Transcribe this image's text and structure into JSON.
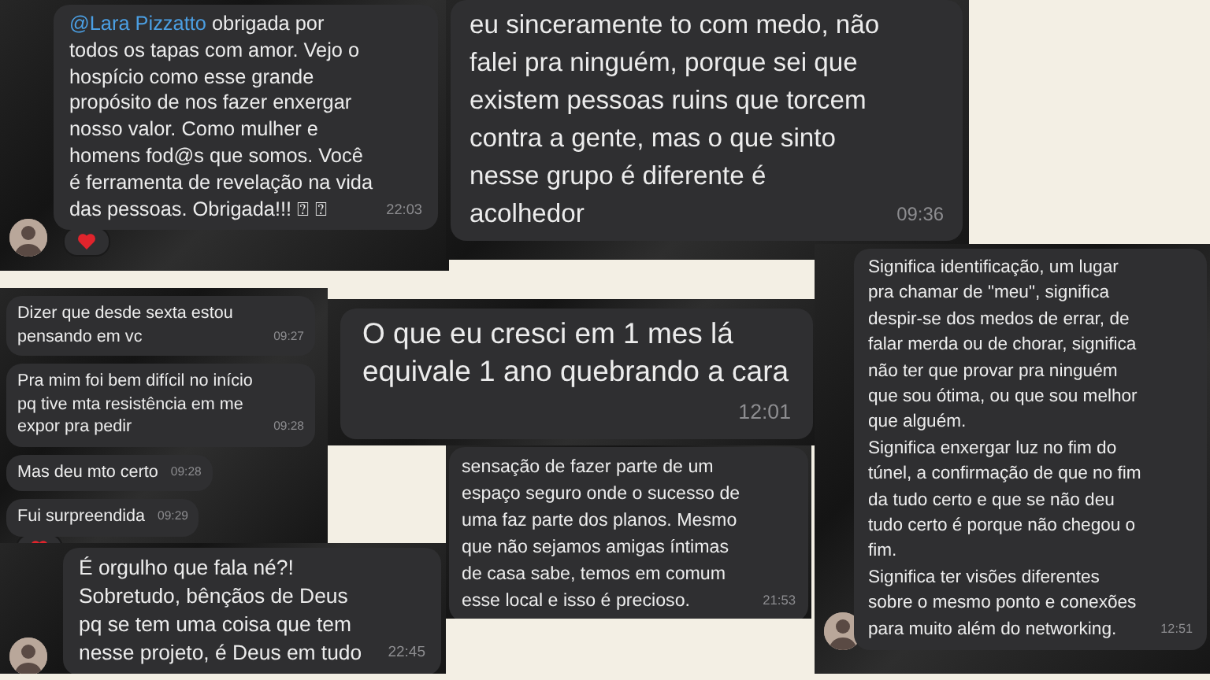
{
  "panels": [
    {
      "messages": [
        {
          "mention": "@Lara Pizzatto",
          "text": " obrigada por todos os tapas com amor. Vejo o hospício como esse grande propósito de nos fazer enxergar nosso valor. Como mulher e homens fod@s que somos. Você é ferramenta de revelação na vida das pessoas. Obrigada!!! ⍰ ⍰",
          "time": "22:03",
          "avatar": true,
          "reaction": true
        }
      ]
    },
    {
      "messages": [
        {
          "text": "eu sinceramente to com medo, não falei pra ninguém, porque sei que existem pessoas ruins que torcem contra a gente, mas o que sinto nesse grupo é diferente é acolhedor",
          "time": "09:36",
          "avatar": false,
          "reaction": false
        }
      ]
    },
    {
      "messages": [
        {
          "text": "Dizer que desde sexta estou pensando em vc",
          "time": "09:27",
          "avatar": false,
          "reaction": false
        },
        {
          "text": "Pra mim foi bem difícil no início pq tive mta resistência em me expor pra pedir",
          "time": "09:28",
          "avatar": false,
          "reaction": false
        },
        {
          "text": "Mas deu mto certo",
          "time": "09:28",
          "avatar": false,
          "reaction": false
        },
        {
          "text": "Fui surpreendida",
          "time": "09:29",
          "avatar": false,
          "reaction": true
        }
      ]
    },
    {
      "messages": [
        {
          "text": "O que eu cresci em 1 mes lá equivale 1 ano quebrando a cara",
          "time": "12:01",
          "avatar": false,
          "reaction": false
        }
      ]
    },
    {
      "messages": [
        {
          "text": "sensação de fazer parte de um espaço seguro onde o sucesso de uma faz parte dos planos. Mesmo que não sejamos amigas íntimas de casa sabe, temos em comum esse local e isso é precioso.",
          "time": "21:53",
          "avatar": false,
          "reaction": false
        }
      ]
    },
    {
      "messages": [
        {
          "text": "É orgulho que fala né?!\nSobretudo, bênçãos de Deus pq se tem uma coisa que tem nesse projeto, é Deus em tudo",
          "time": "22:45",
          "avatar": true,
          "reaction": false
        }
      ]
    },
    {
      "messages": [
        {
          "text": "Significa identificação, um lugar pra chamar de \"meu\", significa despir-se dos medos de errar, de falar merda ou de chorar, significa não ter que provar pra ninguém que sou ótima, ou que sou melhor que alguém.\nSignifica enxergar luz no fim do túnel, a confirmação de que no fim da tudo certo e que se não deu tudo certo é porque não chegou o fim.\nSignifica ter visões diferentes sobre o mesmo ponto e conexões para muito além do networking.",
          "time": "12:51",
          "avatar": true,
          "reaction": false
        }
      ]
    }
  ]
}
